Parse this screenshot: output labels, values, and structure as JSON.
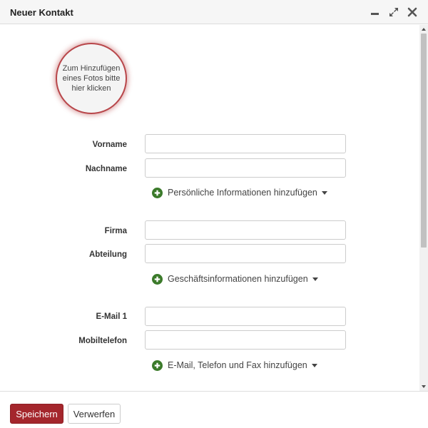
{
  "window": {
    "title": "Neuer Kontakt",
    "controls": {
      "minimize": "minimize-icon",
      "maximize": "expand-icon",
      "close": "close-icon"
    }
  },
  "photo": {
    "text": "Zum Hinzufügen eines Fotos bitte hier klicken"
  },
  "form": {
    "vorname": {
      "label": "Vorname",
      "value": ""
    },
    "nachname": {
      "label": "Nachname",
      "value": ""
    },
    "personal_link": "Persönliche Informationen hinzufügen",
    "firma": {
      "label": "Firma",
      "value": ""
    },
    "abteilung": {
      "label": "Abteilung",
      "value": ""
    },
    "business_link": "Geschäftsinformationen hinzufügen",
    "email1": {
      "label": "E-Mail 1",
      "value": ""
    },
    "mobil": {
      "label": "Mobiltelefon",
      "value": ""
    },
    "contact_link": "E-Mail, Telefon und Fax hinzufügen"
  },
  "footer": {
    "save_label": "Speichern",
    "discard_label": "Verwerfen"
  },
  "colors": {
    "accent": "#a4262c",
    "plus_icon": "#3b7a2a",
    "photo_ring": "#b8464a"
  }
}
